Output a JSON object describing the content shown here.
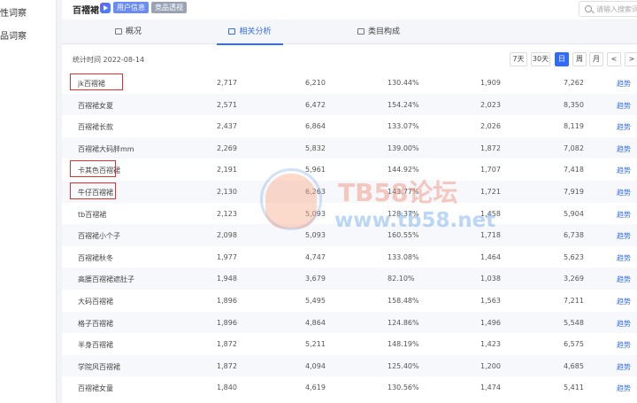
{
  "sidebar": {
    "items": [
      {
        "label": "性词察"
      },
      {
        "label": "品词察"
      }
    ]
  },
  "header": {
    "keyword": "百褶裙",
    "tags": [
      {
        "label": "用户信息"
      },
      {
        "label": "竞品透视"
      }
    ],
    "search_placeholder": "请输入搜索词"
  },
  "tabs": [
    {
      "label": "概况",
      "active": false
    },
    {
      "label": "相关分析",
      "active": true
    },
    {
      "label": "类目构成",
      "active": false
    }
  ],
  "stat_time": "统计时间 2022-08-14",
  "ranges": [
    {
      "label": "7天",
      "active": false
    },
    {
      "label": "30天",
      "active": false
    },
    {
      "label": "日",
      "active": true
    },
    {
      "label": "周",
      "active": false
    },
    {
      "label": "月",
      "active": false
    },
    {
      "label": "<",
      "active": false
    },
    {
      "label": ">",
      "active": false
    }
  ],
  "table": {
    "rows": [
      {
        "kw": "jk百褶裙",
        "v1": "2,717",
        "v2": "6,210",
        "v3": "130.44%",
        "v4": "1,909",
        "v5": "7,262",
        "link": "趋势",
        "highlighted": true
      },
      {
        "kw": "百褶裙女夏",
        "v1": "2,571",
        "v2": "6,472",
        "v3": "154.24%",
        "v4": "2,023",
        "v5": "8,350",
        "link": "趋势",
        "highlighted": false
      },
      {
        "kw": "百褶裙长款",
        "v1": "2,437",
        "v2": "6,864",
        "v3": "133.07%",
        "v4": "2,026",
        "v5": "8,119",
        "link": "趋势",
        "highlighted": false
      },
      {
        "kw": "百褶裙大码胖mm",
        "v1": "2,269",
        "v2": "5,832",
        "v3": "139.00%",
        "v4": "1,872",
        "v5": "7,082",
        "link": "趋势",
        "highlighted": false
      },
      {
        "kw": "卡其色百褶裙",
        "v1": "2,191",
        "v2": "5,961",
        "v3": "144.92%",
        "v4": "1,707",
        "v5": "7,418",
        "link": "趋势",
        "highlighted": true
      },
      {
        "kw": "牛仔百褶裙",
        "v1": "2,130",
        "v2": "6,263",
        "v3": "143.77%",
        "v4": "1,721",
        "v5": "7,919",
        "link": "趋势",
        "highlighted": true
      },
      {
        "kw": "tb百褶裙",
        "v1": "2,123",
        "v2": "5,093",
        "v3": "128.37%",
        "v4": "1,458",
        "v5": "5,904",
        "link": "趋势",
        "highlighted": false
      },
      {
        "kw": "百褶裙小个子",
        "v1": "2,098",
        "v2": "5,093",
        "v3": "160.55%",
        "v4": "1,718",
        "v5": "6,738",
        "link": "趋势",
        "highlighted": false
      },
      {
        "kw": "百褶裙秋冬",
        "v1": "1,977",
        "v2": "4,747",
        "v3": "133.08%",
        "v4": "1,464",
        "v5": "5,623",
        "link": "趋势",
        "highlighted": false
      },
      {
        "kw": "高腰百褶裙遮肚子",
        "v1": "1,948",
        "v2": "3,679",
        "v3": "82.10%",
        "v4": "1,038",
        "v5": "3,269",
        "link": "趋势",
        "highlighted": false
      },
      {
        "kw": "大码百褶裙",
        "v1": "1,896",
        "v2": "5,495",
        "v3": "158.48%",
        "v4": "1,563",
        "v5": "7,211",
        "link": "趋势",
        "highlighted": false
      },
      {
        "kw": "格子百褶裙",
        "v1": "1,896",
        "v2": "4,864",
        "v3": "124.86%",
        "v4": "1,496",
        "v5": "5,548",
        "link": "趋势",
        "highlighted": false
      },
      {
        "kw": "半身百褶裙",
        "v1": "1,872",
        "v2": "5,211",
        "v3": "148.19%",
        "v4": "1,423",
        "v5": "6,575",
        "link": "趋势",
        "highlighted": false
      },
      {
        "kw": "学院风百褶裙",
        "v1": "1,872",
        "v2": "4,094",
        "v3": "125.40%",
        "v4": "1,200",
        "v5": "4,685",
        "link": "趋势",
        "highlighted": false
      },
      {
        "kw": "百褶裙女童",
        "v1": "1,840",
        "v2": "4,619",
        "v3": "130.56%",
        "v4": "1,474",
        "v5": "5,411",
        "link": "趋势",
        "highlighted": false
      }
    ]
  },
  "watermark": {
    "line1": "TB58论坛",
    "line2": "www.tb58.net"
  }
}
